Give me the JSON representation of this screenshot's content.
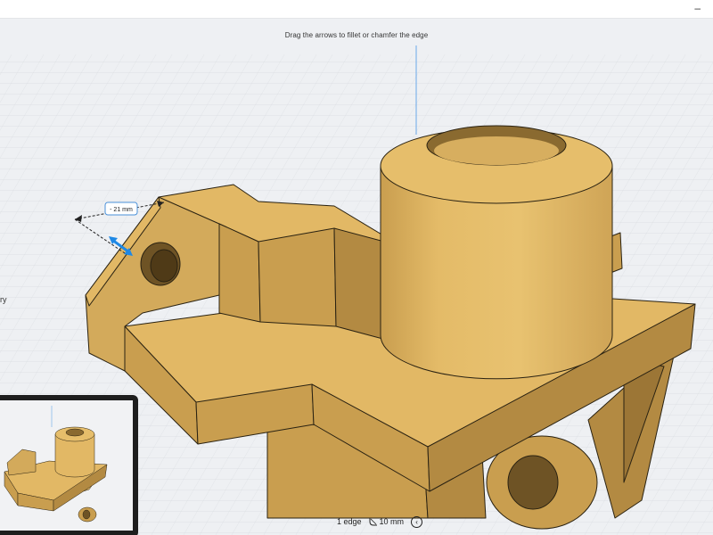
{
  "window": {
    "minimize_glyph": "–"
  },
  "viewport": {
    "hint": "Drag the arrows to fillet or chamfer the edge",
    "side_text": "ry"
  },
  "measure": {
    "label": "- 21 mm"
  },
  "status": {
    "selection": "1 edge",
    "length": "10 mm",
    "length_icon": "fillet-radius-icon",
    "options_glyph": "‹"
  },
  "colors": {
    "part_top": "#e2b865",
    "part_front": "#c99e4f",
    "part_side": "#b38a42",
    "part_dark": "#9c7636",
    "grid": "#d4d7dc",
    "accent": "#1e88e5"
  }
}
